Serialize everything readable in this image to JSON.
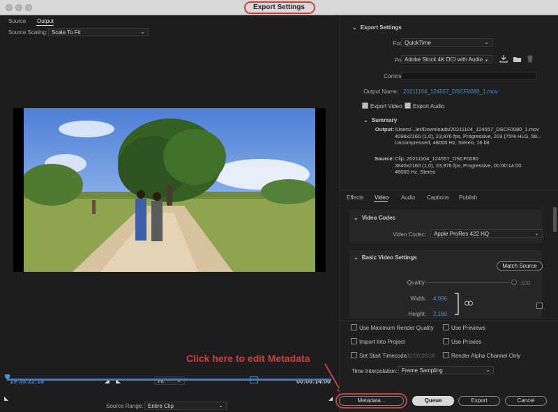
{
  "window": {
    "title": "Export Settings"
  },
  "source_tabs": {
    "source": "Source",
    "output": "Output"
  },
  "scaling": {
    "label": "Source Scaling:",
    "value": "Scale To Fit"
  },
  "timeline": {
    "in_timecode": "19:35:22:18",
    "zoom": "Fit",
    "duration": "00:00:14:00",
    "source_range_label": "Source Range:",
    "source_range_value": "Entire Clip"
  },
  "callout": {
    "text": "Click here to edit Metadata"
  },
  "export_settings": {
    "heading": "Export Settings",
    "format_label": "Format:",
    "format_value": "QuickTime",
    "preset_label": "Preset:",
    "preset_value": "Adobe Stock 4K DCI with Audio ...",
    "comments_label": "Comments:",
    "comments_value": "",
    "output_name_label": "Output Name:",
    "output_name_value": "20211104_124557_DSCF0080_1.mov",
    "export_video_label": "Export Video",
    "export_video_checked": true,
    "export_audio_label": "Export Audio",
    "export_audio_checked": true
  },
  "summary": {
    "heading": "Summary",
    "output_label": "Output:",
    "output_lines": [
      "/Users/...ler/Downloads/20211104_124557_DSCF0080_1.mov",
      "4096x2160 (1,0), 23,976 fps, Progressive, 203 (75% HLG, 58...",
      "Uncompressed, 48000 Hz, Stereo, 16 bit"
    ],
    "source_label": "Source:",
    "source_lines": [
      "Clip, 20211104_124557_DSCF0080",
      "3840x2160 (1,0), 23,976 fps, Progressive, 00:00:14:00",
      "48000 Hz, Stereo"
    ]
  },
  "settings_tabs": [
    "Effects",
    "Video",
    "Audio",
    "Captions",
    "Publish"
  ],
  "video_codec": {
    "heading": "Video Codec",
    "codec_label": "Video Codec:",
    "codec_value": "Apple ProRes 422 HQ"
  },
  "basic_video": {
    "heading": "Basic Video Settings",
    "match_source": "Match Source",
    "quality_label": "Quality:",
    "quality_value": "100",
    "quality_level": 1.0,
    "width_label": "Width:",
    "width_value": "4.096",
    "height_label": "Height:",
    "height_value": "2.160"
  },
  "options": {
    "use_max_render_quality": "Use Maximum Render Quality",
    "use_previews": "Use Previews",
    "import_into_project": "Import Into Project",
    "use_proxies": "Use Proxies",
    "set_start_timecode": "Set Start Timecode",
    "start_timecode_value": "00:00:00:00",
    "render_alpha_only": "Render Alpha Channel Only",
    "time_interpolation_label": "Time Interpolation:",
    "time_interpolation_value": "Frame Sampling"
  },
  "footer": {
    "metadata": "Metadata...",
    "queue": "Queue",
    "export": "Export",
    "cancel": "Cancel"
  },
  "colors": {
    "accent_blue": "#4a8fd6",
    "annotation_red": "#c9413d",
    "panel_bg": "#1f1f1f"
  }
}
